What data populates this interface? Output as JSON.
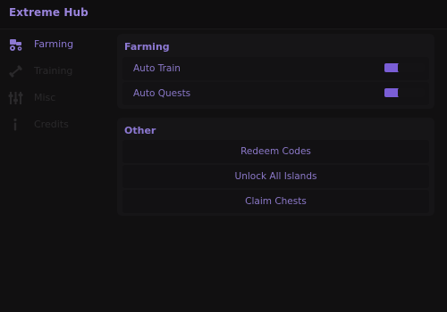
{
  "app": {
    "title": "Extreme Hub"
  },
  "sidebar": {
    "items": [
      {
        "label": "Farming",
        "icon": "tractor-icon",
        "active": true
      },
      {
        "label": "Training",
        "icon": "dumbbell-icon",
        "active": false
      },
      {
        "label": "Misc",
        "icon": "sliders-icon",
        "active": false
      },
      {
        "label": "Credits",
        "icon": "info-icon",
        "active": false
      }
    ]
  },
  "farming": {
    "title": "Farming",
    "toggles": [
      {
        "label": "Auto Train",
        "enabled": true
      },
      {
        "label": "Auto Quests",
        "enabled": true
      }
    ]
  },
  "other": {
    "title": "Other",
    "buttons": [
      {
        "label": "Redeem Codes"
      },
      {
        "label": "Unlock All Islands"
      },
      {
        "label": "Claim Chests"
      }
    ]
  },
  "colors": {
    "accent": "#7a5ed6",
    "text_accent": "#8c78d2",
    "background": "#111011"
  }
}
